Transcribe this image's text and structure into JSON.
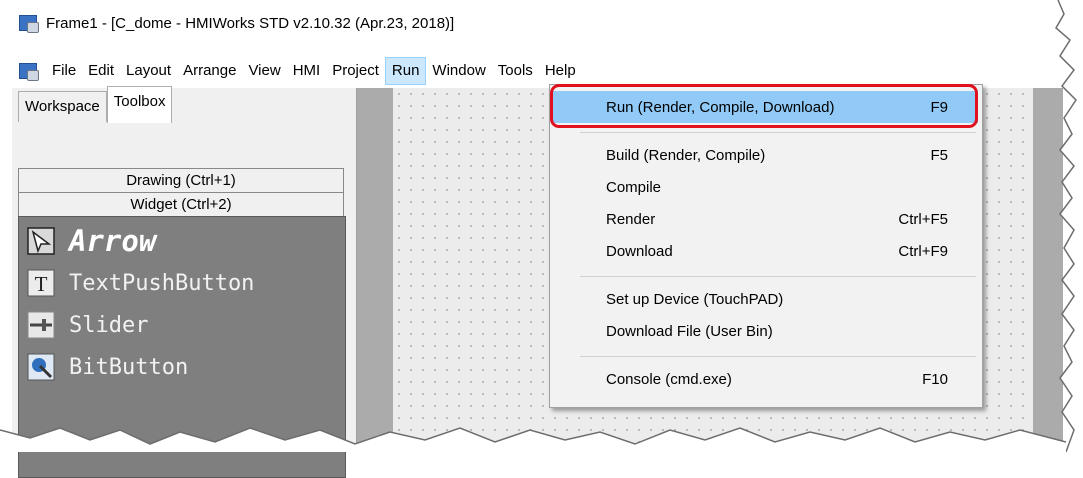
{
  "window": {
    "title": "Frame1 - [C_dome - HMIWorks STD v2.10.32 (Apr.23, 2018)]"
  },
  "menubar": {
    "items": [
      "File",
      "Edit",
      "Layout",
      "Arrange",
      "View",
      "HMI",
      "Project",
      "Run",
      "Window",
      "Tools",
      "Help"
    ],
    "active": "Run"
  },
  "panel": {
    "tabs": [
      "Workspace",
      "Toolbox"
    ],
    "active_tab": "Toolbox",
    "categories": [
      "Drawing (Ctrl+1)",
      "Widget (Ctrl+2)"
    ],
    "tools": [
      {
        "label": "Arrow",
        "icon": "arrow-pointer-icon",
        "selected": true
      },
      {
        "label": "TextPushButton",
        "icon": "text-push-button-icon",
        "selected": false
      },
      {
        "label": "Slider",
        "icon": "slider-icon",
        "selected": false
      },
      {
        "label": "BitButton",
        "icon": "bit-button-icon",
        "selected": false
      }
    ]
  },
  "run_menu": {
    "items": [
      {
        "label": "Run (Render, Compile, Download)",
        "shortcut": "F9",
        "highlighted": true
      },
      {
        "label": "Build (Render, Compile)",
        "shortcut": "F5"
      },
      {
        "label": "Compile",
        "shortcut": ""
      },
      {
        "label": "Render",
        "shortcut": "Ctrl+F5"
      },
      {
        "label": "Download",
        "shortcut": "Ctrl+F9"
      },
      {
        "label": "Set up Device (TouchPAD)",
        "shortcut": ""
      },
      {
        "label": "Download File (User Bin)",
        "shortcut": ""
      },
      {
        "label": "Console (cmd.exe)",
        "shortcut": "F10"
      }
    ]
  },
  "colors": {
    "highlight": "#91c9f7",
    "callout": "#e0101c",
    "menu_active": "#cce8ff"
  }
}
